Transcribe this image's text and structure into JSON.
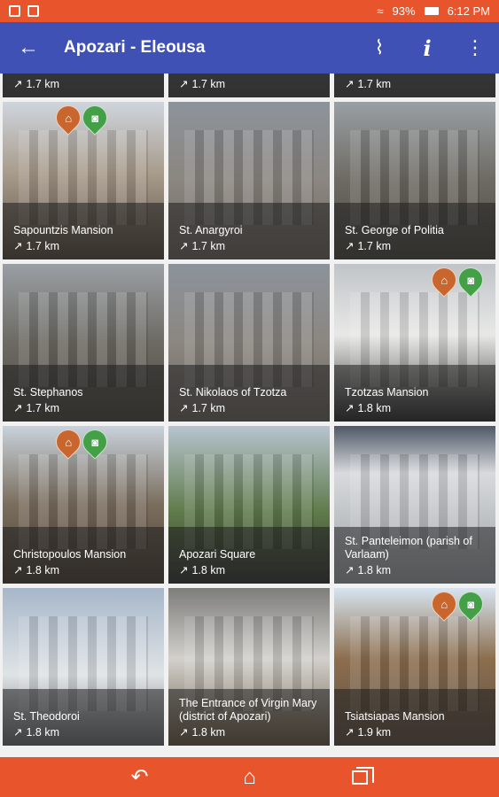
{
  "status": {
    "battery": "93%",
    "time": "6:12 PM",
    "icons": [
      "notification-icon",
      "image-icon",
      "wifi-icon",
      "battery-icon"
    ]
  },
  "app_bar": {
    "title": "Apozari - Eleousa",
    "back_icon": "arrow-back-icon",
    "actions": [
      "map-route-icon",
      "info-icon",
      "more-vert-icon"
    ]
  },
  "tiles": [
    {
      "name": "",
      "distance": "1.7 km"
    },
    {
      "name": "",
      "distance": "1.7 km"
    },
    {
      "name": "",
      "distance": "1.7 km"
    },
    {
      "name": "Sapountzis Mansion",
      "distance": "1.7 km",
      "pins": [
        "museum",
        "camera"
      ]
    },
    {
      "name": "St. Anargyroi",
      "distance": "1.7 km"
    },
    {
      "name": "St. George of Politia",
      "distance": "1.7 km"
    },
    {
      "name": "St. Stephanos",
      "distance": "1.7 km"
    },
    {
      "name": "St. Nikolaos of Tzotza",
      "distance": "1.7 km"
    },
    {
      "name": "Tzotzas Mansion",
      "distance": "1.8 km",
      "pins": [
        "museum",
        "camera"
      ]
    },
    {
      "name": "Christopoulos Mansion",
      "distance": "1.8 km",
      "pins": [
        "museum",
        "camera"
      ]
    },
    {
      "name": "Apozari Square",
      "distance": "1.8 km"
    },
    {
      "name": "St. Panteleimon (parish of Varlaam)",
      "distance": "1.8 km"
    },
    {
      "name": "St. Theodoroi",
      "distance": "1.8 km"
    },
    {
      "name": "The Entrance of Virgin Mary (district of Apozari)",
      "distance": "1.8 km"
    },
    {
      "name": "Tsiatsiapas Mansion",
      "distance": "1.9 km",
      "pins": [
        "museum",
        "camera"
      ]
    }
  ],
  "nav": {
    "icons": [
      "back-nav-icon",
      "home-nav-icon",
      "recent-apps-icon"
    ]
  },
  "colors": {
    "status_bar": "#e8552c",
    "app_bar": "#3f51b5",
    "museum_pin": "#c8662e",
    "camera_pin": "#43a047"
  }
}
